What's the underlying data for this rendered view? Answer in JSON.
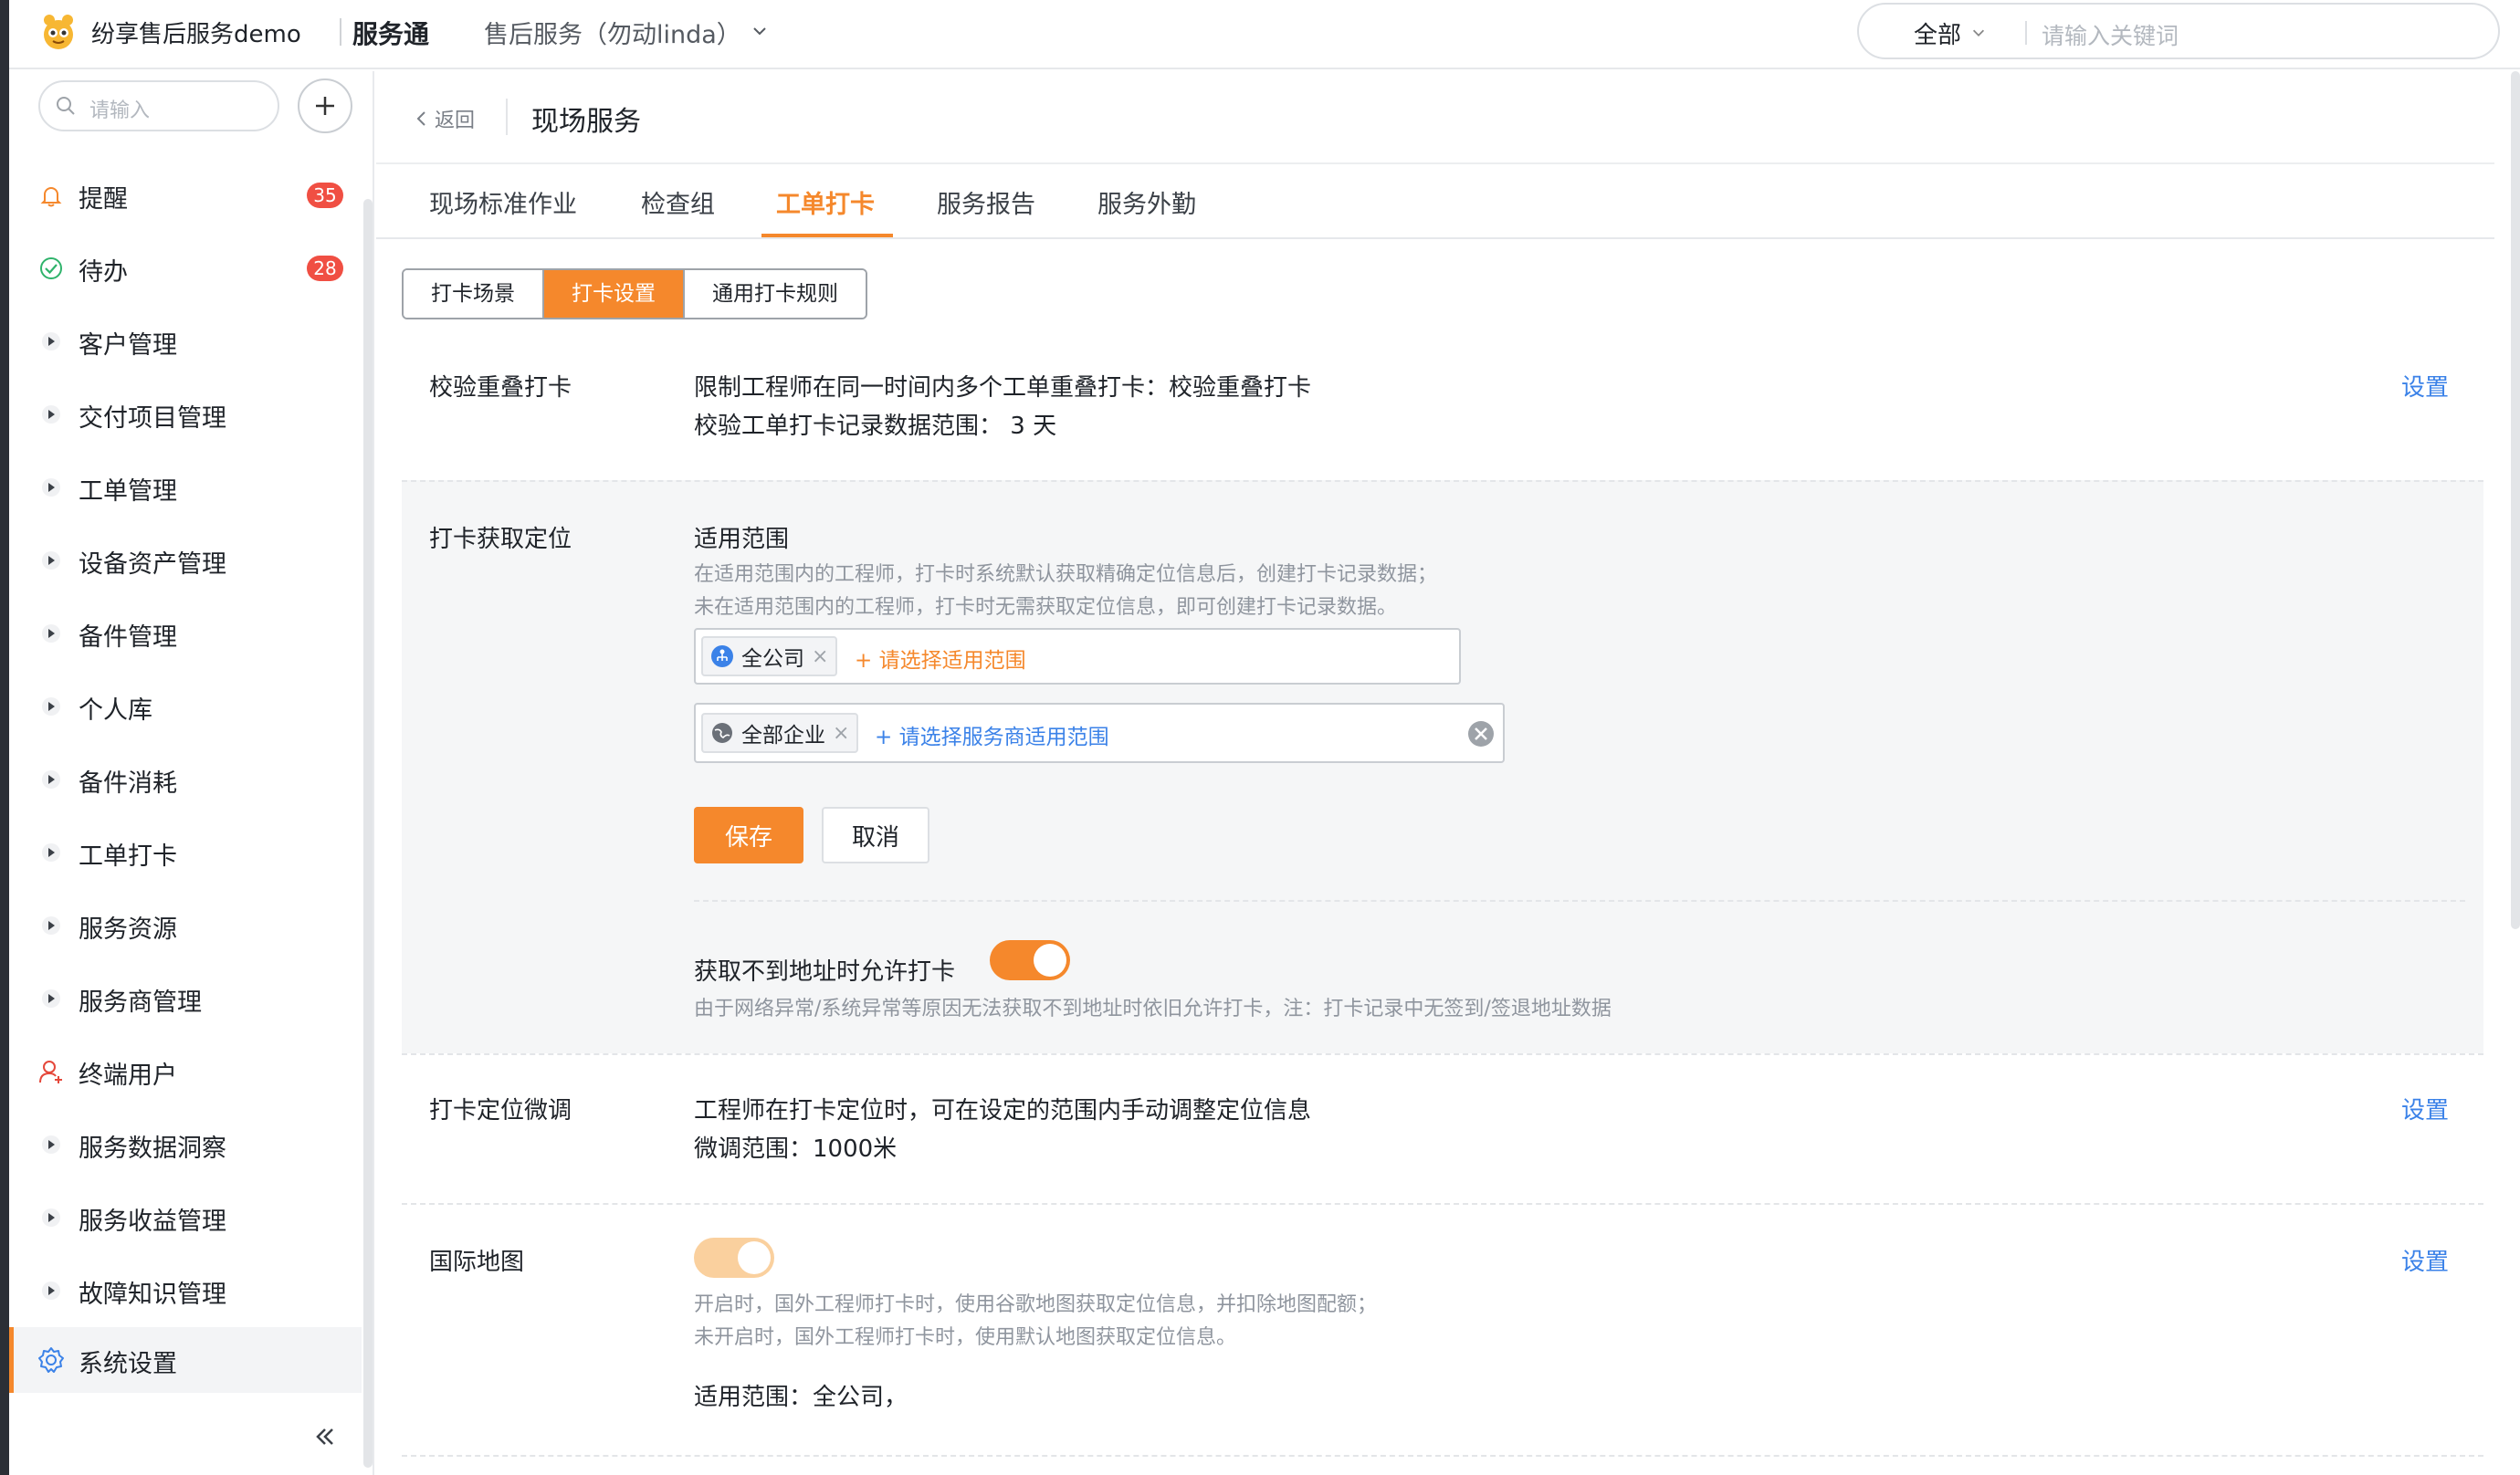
{
  "header": {
    "app_title": "纷享售后服务demo",
    "product": "服务通",
    "tenant": "售后服务（勿动linda）",
    "search_scope": "全部",
    "search_placeholder": "请输入关键词"
  },
  "sidebar": {
    "search_placeholder": "请输入",
    "items": [
      {
        "label": "提醒",
        "icon": "bell-icon",
        "badge": "35"
      },
      {
        "label": "待办",
        "icon": "check-circle-icon",
        "badge": "28"
      },
      {
        "label": "客户管理",
        "icon": "caret-right-icon"
      },
      {
        "label": "交付项目管理",
        "icon": "caret-right-icon"
      },
      {
        "label": "工单管理",
        "icon": "caret-right-icon"
      },
      {
        "label": "设备资产管理",
        "icon": "caret-right-icon"
      },
      {
        "label": "备件管理",
        "icon": "caret-right-icon"
      },
      {
        "label": "个人库",
        "icon": "caret-right-icon"
      },
      {
        "label": "备件消耗",
        "icon": "caret-right-icon"
      },
      {
        "label": "工单打卡",
        "icon": "caret-right-icon"
      },
      {
        "label": "服务资源",
        "icon": "caret-right-icon"
      },
      {
        "label": "服务商管理",
        "icon": "caret-right-icon"
      },
      {
        "label": "终端用户",
        "icon": "user-icon"
      },
      {
        "label": "服务数据洞察",
        "icon": "caret-right-icon"
      },
      {
        "label": "服务收益管理",
        "icon": "caret-right-icon"
      },
      {
        "label": "故障知识管理",
        "icon": "caret-right-icon"
      },
      {
        "label": "系统设置",
        "icon": "gear-icon"
      }
    ]
  },
  "page": {
    "back": "返回",
    "title": "现场服务",
    "tabs": [
      "现场标准作业",
      "检查组",
      "工单打卡",
      "服务报告",
      "服务外勤"
    ],
    "active_tab": "工单打卡",
    "segments": [
      "打卡场景",
      "打卡设置",
      "通用打卡规则"
    ],
    "active_segment": "打卡设置"
  },
  "overlap": {
    "label": "校验重叠打卡",
    "line1": "限制工程师在同一时间内多个工单重叠打卡：校验重叠打卡",
    "line2": "校验工单打卡记录数据范围：  3 天",
    "action": "设置"
  },
  "location": {
    "label": "打卡获取定位",
    "scope_title": "适用范围",
    "hint1": "在适用范围内的工程师，打卡时系统默认获取精确定位信息后，创建打卡记录数据；",
    "hint2": "未在适用范围内的工程师，打卡时无需获取定位信息，即可创建打卡记录数据。",
    "chip1": "全公司",
    "add1": "+ 请选择适用范围",
    "chip2": "全部企业",
    "add2": "+ 请选择服务商适用范围",
    "save": "保存",
    "cancel": "取消",
    "allow_label": "获取不到地址时允许打卡",
    "allow_on": true,
    "allow_hint": "由于网络异常/系统异常等原因无法获取不到地址时依旧允许打卡，注：打卡记录中无签到/签退地址数据"
  },
  "finetune": {
    "label": "打卡定位微调",
    "line1": "工程师在打卡定位时，可在设定的范围内手动调整定位信息",
    "line2": "微调范围：1000米",
    "action": "设置"
  },
  "intl_map": {
    "label": "国际地图",
    "enabled": true,
    "hint1": "开启时，国外工程师打卡时，使用谷歌地图获取定位信息，并扣除地图配额；",
    "hint2": "未开启时，国外工程师打卡时，使用默认地图获取定位信息。",
    "scope": "适用范围：全公司，",
    "action": "设置"
  },
  "colors": {
    "accent": "#f5882c",
    "link": "#3b82e8",
    "badge": "#f04f43"
  }
}
